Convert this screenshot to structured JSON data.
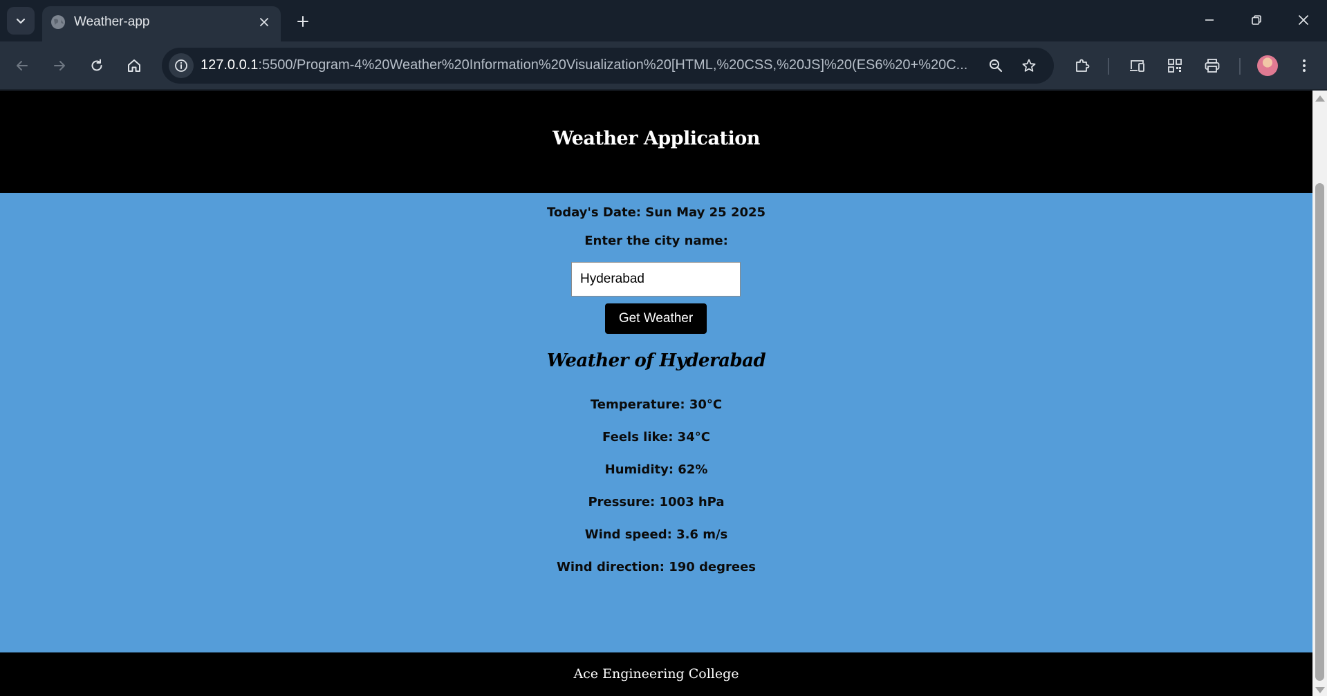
{
  "browser": {
    "tab_title": "Weather-app",
    "url_host": "127.0.0.1",
    "url_rest": ":5500/Program-4%20Weather%20Information%20Visualization%20[HTML,%20CSS,%20JS]%20(ES6%20+%20C..."
  },
  "page": {
    "title": "Weather Application",
    "date_text": "Today's Date: Sun May 25 2025",
    "city_prompt": "Enter the city name:",
    "city_input_value": "Hyderabad",
    "get_button": "Get Weather",
    "weather_heading": "Weather of Hyderabad",
    "temperature": "Temperature: 30°C",
    "feels_like": "Feels like: 34°C",
    "humidity": "Humidity: 62%",
    "pressure": "Pressure: 1003 hPa",
    "wind_speed": "Wind speed: 3.6 m/s",
    "wind_direction": "Wind direction: 190 degrees",
    "footer": "Ace Engineering College"
  },
  "colors": {
    "page_background": "#559dd9",
    "header_footer": "#000000",
    "button": "#000000"
  }
}
